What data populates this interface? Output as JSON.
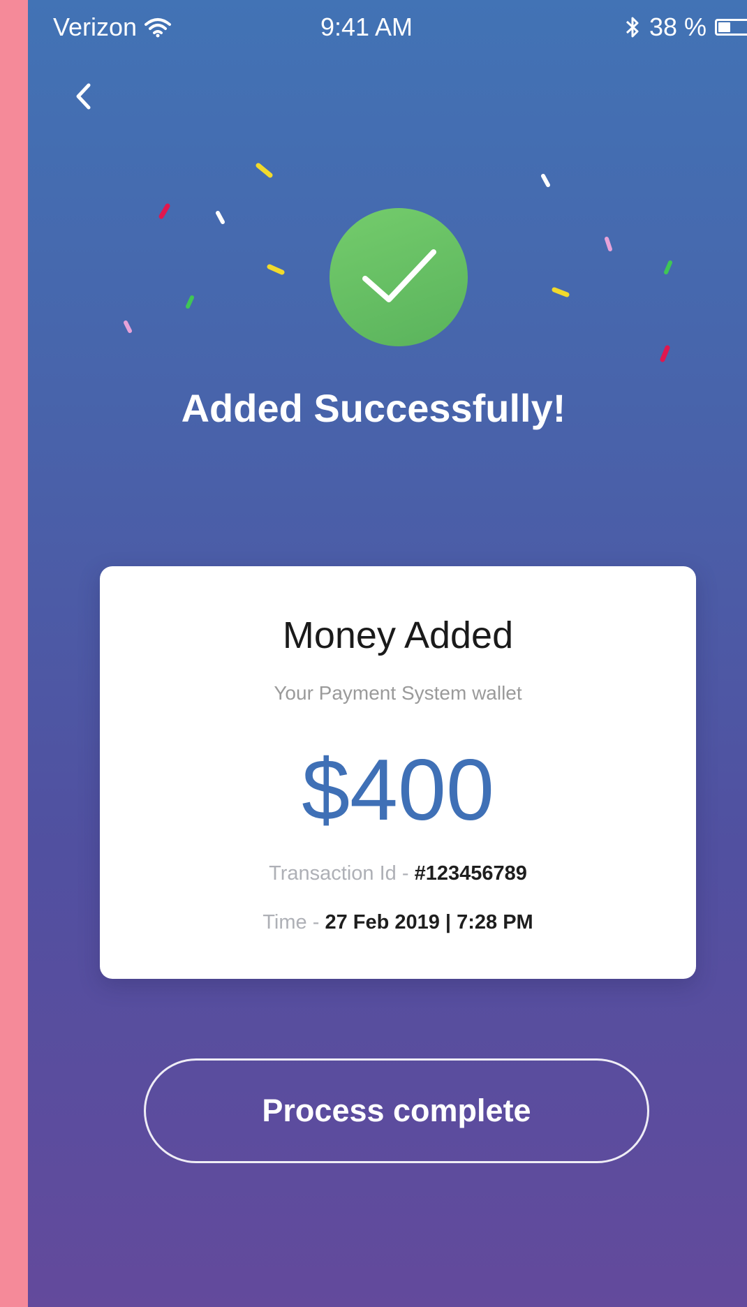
{
  "status_bar": {
    "carrier": "Verizon",
    "time": "9:41 AM",
    "battery_percent": "38 %",
    "battery_level": 0.38,
    "icons": [
      "wifi-icon",
      "bluetooth-icon",
      "battery-icon"
    ]
  },
  "nav": {
    "back_icon": "chevron-left-icon"
  },
  "success": {
    "icon": "checkmark-icon",
    "headline": "Added Successfully!"
  },
  "card": {
    "title": "Money Added",
    "subtitle": "Your Payment System wallet",
    "amount": "$400",
    "transaction_label": "Transaction Id -",
    "transaction_id": "#123456789",
    "time_label": "Time -",
    "time_value": "27 Feb 2019 | 7:28 PM"
  },
  "action": {
    "button_label": "Process complete"
  },
  "colors": {
    "page_background": "#f58a99",
    "gradient_top": "#4273b5",
    "gradient_bottom": "#634a9c",
    "success_green": "#66c164",
    "amount_blue": "#3f70b6"
  }
}
